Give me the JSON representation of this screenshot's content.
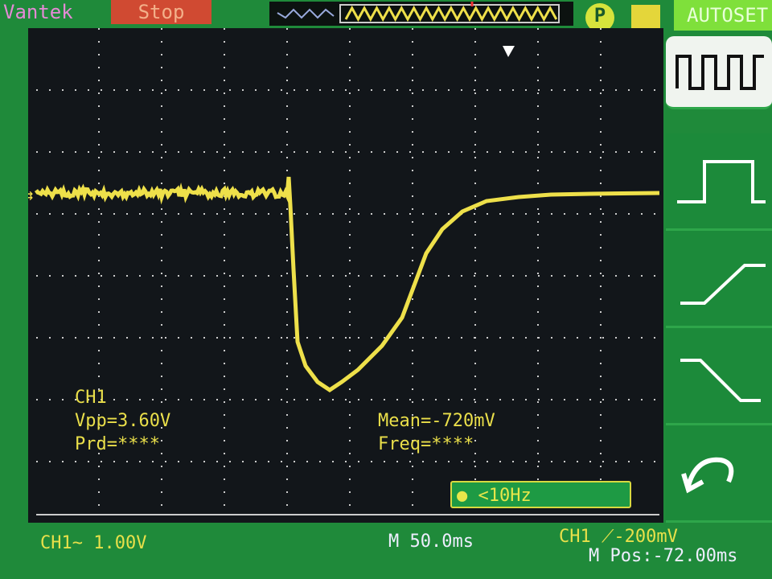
{
  "header": {
    "brand": "Vantek",
    "run_state": "Stop",
    "autoset": "AUTOSET",
    "p_icon": "P"
  },
  "menu": {
    "items": [
      {
        "icon": "square-wave-icon",
        "selected": true
      },
      {
        "icon": "single-pulse-icon"
      },
      {
        "icon": "rising-edge-icon"
      },
      {
        "icon": "falling-edge-icon"
      },
      {
        "icon": "undo-icon"
      }
    ]
  },
  "measurements": {
    "channel": "CH1",
    "vpp": "Vpp=3.60V",
    "prd": "Prd=****",
    "mean": "Mean=-720mV",
    "freq": "Freq=****"
  },
  "freq_counter": "<10Hz",
  "status": {
    "ch1_scale": "CH1~ 1.00V",
    "timebase": "M 50.0ms",
    "trigger": "CH1 ⟋-200mV",
    "mpos": "M Pos:-72.00ms"
  },
  "colors": {
    "bezel": "#1f8a3a",
    "trace": "#eee04a",
    "screen": "#12161a"
  }
}
